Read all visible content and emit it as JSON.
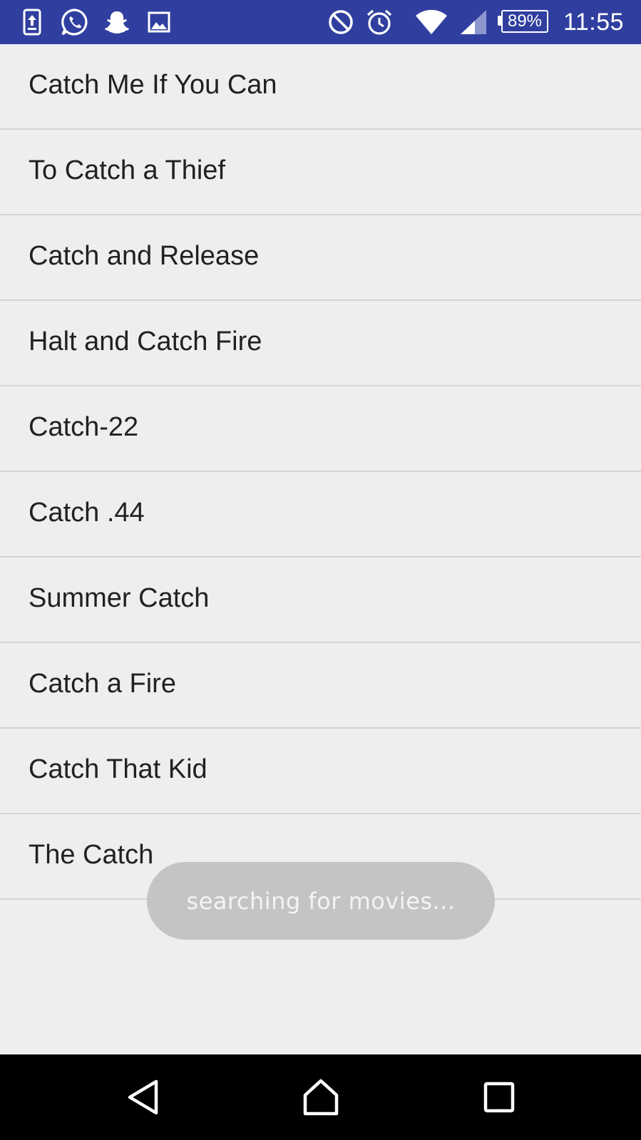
{
  "status_bar": {
    "icons_left": [
      "upload-icon",
      "whatsapp-icon",
      "snapchat-icon",
      "gallery-icon"
    ],
    "icons_right": [
      "do-not-disturb-icon",
      "alarm-icon",
      "wifi-icon",
      "signal-icon"
    ],
    "battery": "89%",
    "time": "11:55",
    "background_color": "#303f9f"
  },
  "movies": [
    "Catch Me If You Can",
    "To Catch a Thief",
    "Catch and Release",
    "Halt and Catch Fire",
    "Catch-22",
    "Catch .44",
    "Summer Catch",
    "Catch a Fire",
    "Catch That Kid",
    "The Catch"
  ],
  "toast": {
    "message": "searching for movies..."
  },
  "nav_bar": {
    "buttons": [
      "back-icon",
      "home-icon",
      "recents-icon"
    ]
  }
}
